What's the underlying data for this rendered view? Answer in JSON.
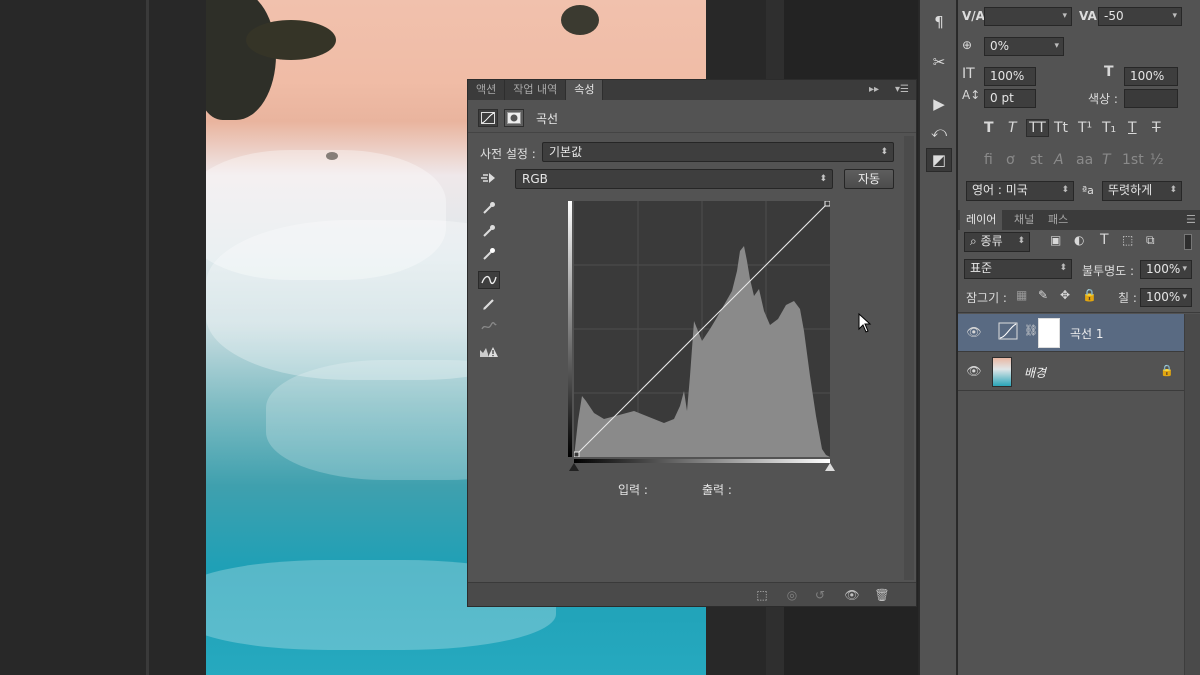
{
  "properties_panel": {
    "tabs": [
      {
        "label": "액션",
        "active": false
      },
      {
        "label": "작업 내역",
        "active": false
      },
      {
        "label": "속성",
        "active": true
      }
    ],
    "collapse_icon": "double-chevron-right-icon",
    "menu_icon": "panel-menu-icon",
    "title": "곡선",
    "preset_label": "사전 설정 :",
    "preset_value": "기본값",
    "channel_value": "RGB",
    "auto_button": "자동",
    "input_label": "입력 :",
    "output_label": "출력 :",
    "tools": [
      "sample-shadow-eyedropper-icon",
      "sample-midtone-eyedropper-icon",
      "sample-highlight-eyedropper-icon",
      "curve-edit-icon",
      "pencil-icon",
      "smooth-icon",
      "clipping-warning-icon"
    ],
    "bottom_icons": [
      "clip-to-layer-icon",
      "view-previous-icon",
      "reset-icon",
      "visibility-eye-icon",
      "trash-icon"
    ]
  },
  "tool_column": {
    "icons": [
      "paragraph-icon",
      "tools-icon",
      "play-icon",
      "history-icon",
      "adjustments-icon"
    ]
  },
  "character_panel": {
    "kerning_value": "",
    "tracking_value": "-50",
    "vertical_shift": "0%",
    "vertical_scale": "100%",
    "horizontal_scale": "100%",
    "baseline_shift": "0 pt",
    "color_label": "색상 :",
    "language": "영어 : 미국",
    "antialias_prefix": "ªa",
    "antialias": "뚜렷하게"
  },
  "layers_panel": {
    "tabs": [
      {
        "label": "레이어",
        "active": true
      },
      {
        "label": "채널",
        "active": false
      },
      {
        "label": "패스",
        "active": false
      }
    ],
    "filter_label": "종류",
    "blend_mode": "표준",
    "opacity_label": "불투명도 :",
    "opacity": "100%",
    "lock_label": "잠그기 :",
    "fill_label": "칠 :",
    "fill": "100%",
    "layers": [
      {
        "name": "곡선 1",
        "type": "adjustment",
        "selected": true
      },
      {
        "name": "배경",
        "type": "background",
        "selected": false,
        "locked": true
      }
    ]
  },
  "colors": {
    "panel_bg": "#535353",
    "selection": "#596a82",
    "workspace": "#282828"
  }
}
